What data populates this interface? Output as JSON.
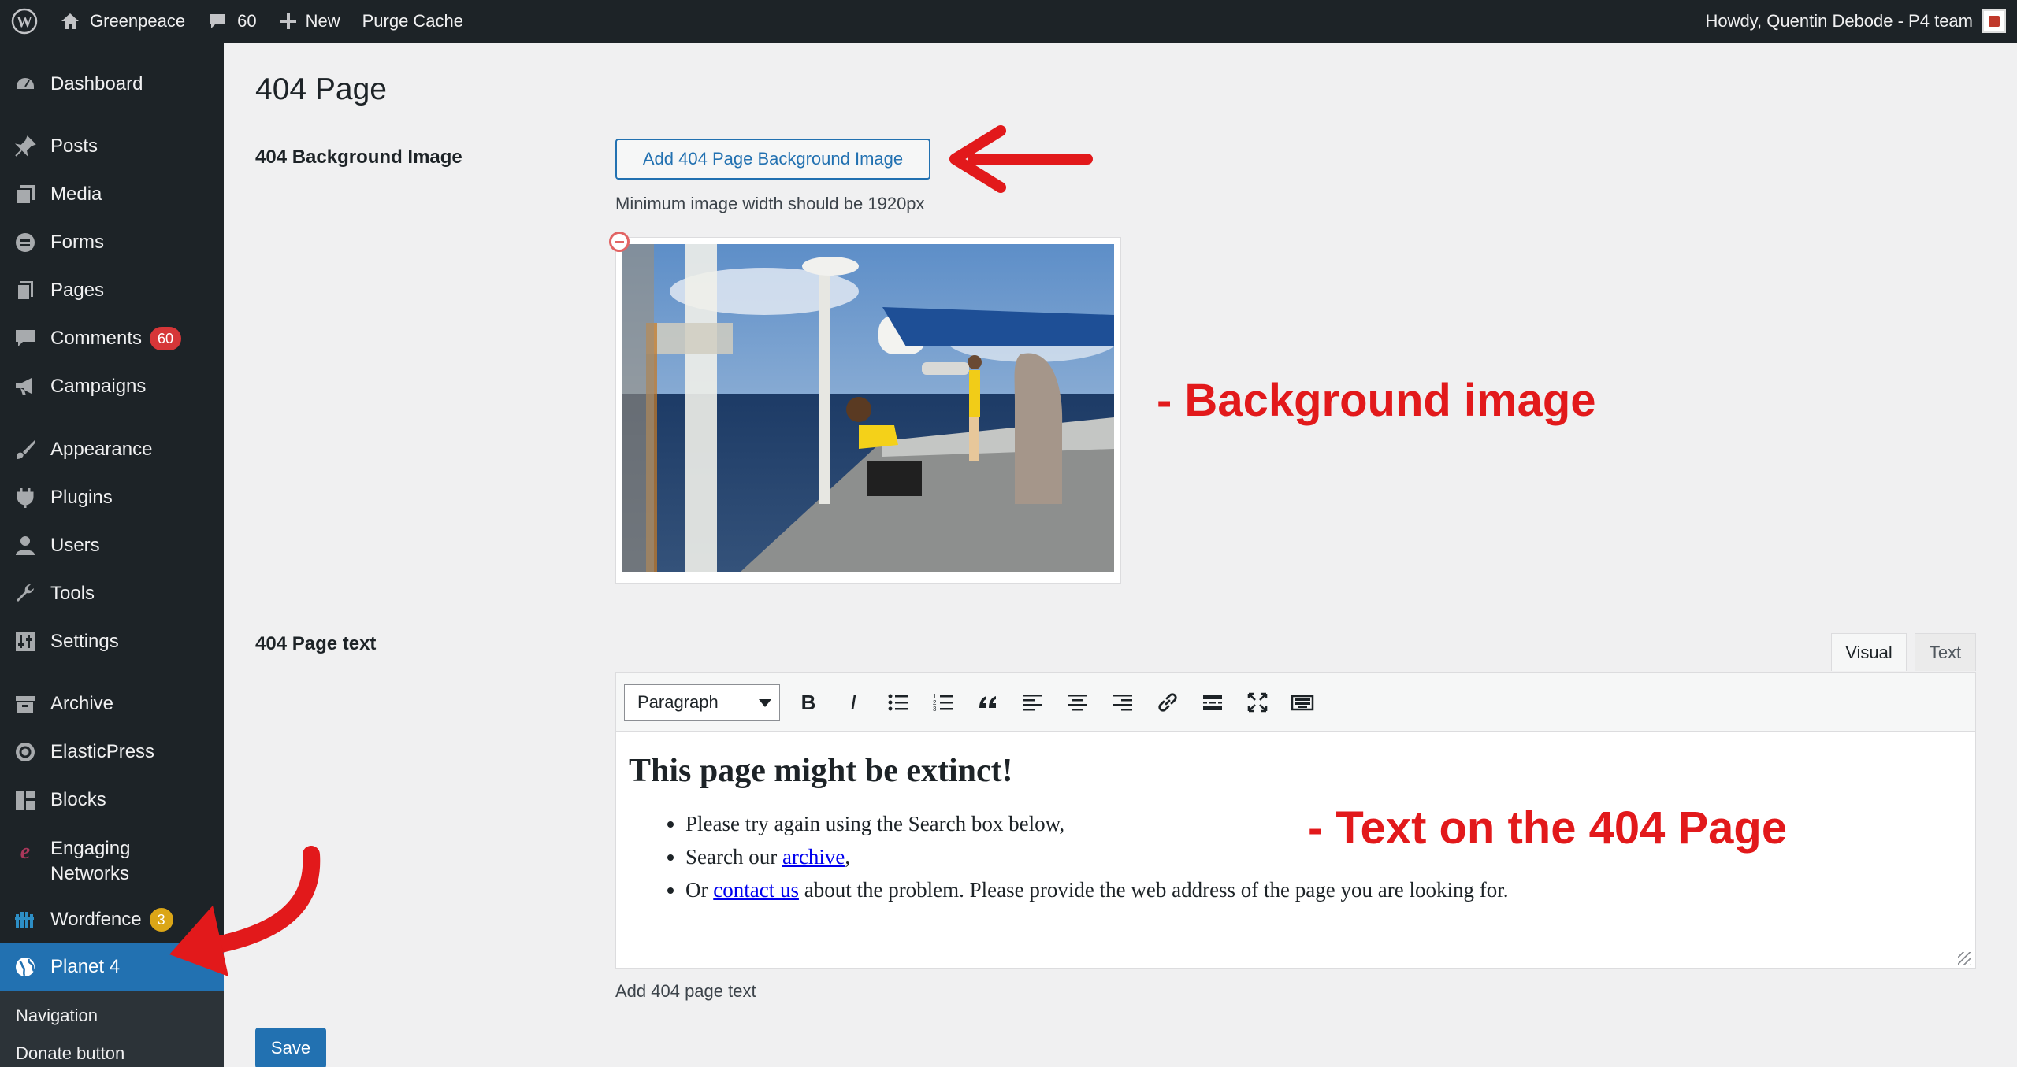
{
  "admin_bar": {
    "site_name": "Greenpeace",
    "comments_count": "60",
    "new_label": "New",
    "purge_cache_label": "Purge Cache",
    "greeting": "Howdy, Quentin Debode - P4 team"
  },
  "sidebar": {
    "items": [
      {
        "label": "Dashboard",
        "icon": "dashboard-icon"
      },
      {
        "label": "Posts",
        "icon": "pin-icon"
      },
      {
        "label": "Media",
        "icon": "media-icon"
      },
      {
        "label": "Forms",
        "icon": "forms-icon"
      },
      {
        "label": "Pages",
        "icon": "pages-icon"
      },
      {
        "label": "Comments",
        "icon": "comments-icon",
        "badge": "60"
      },
      {
        "label": "Campaigns",
        "icon": "megaphone-icon"
      },
      {
        "label": "Appearance",
        "icon": "brush-icon"
      },
      {
        "label": "Plugins",
        "icon": "plugin-icon"
      },
      {
        "label": "Users",
        "icon": "user-icon"
      },
      {
        "label": "Tools",
        "icon": "wrench-icon"
      },
      {
        "label": "Settings",
        "icon": "settings-icon"
      },
      {
        "label": "Archive",
        "icon": "archive-icon"
      },
      {
        "label": "ElasticPress",
        "icon": "elasticpress-icon"
      },
      {
        "label": "Blocks",
        "icon": "blocks-icon"
      },
      {
        "label": "Engaging Networks",
        "icon": "engaging-networks-icon"
      },
      {
        "label": "Wordfence",
        "icon": "wordfence-icon",
        "badge": "3"
      },
      {
        "label": "Planet 4",
        "icon": "globe-icon",
        "current": true
      }
    ],
    "submenu": [
      {
        "label": "Navigation"
      },
      {
        "label": "Donate button"
      }
    ]
  },
  "main": {
    "title": "404 Page",
    "bg_field_label": "404 Background Image",
    "add_bg_button": "Add 404 Page Background Image",
    "min_width_note": "Minimum image width should be 1920px",
    "text_field_label": "404 Page text",
    "editor": {
      "tab_visual": "Visual",
      "tab_text": "Text",
      "format_value": "Paragraph",
      "toolbar_buttons": [
        "bold-icon",
        "italic-icon",
        "bulleted-list-icon",
        "numbered-list-icon",
        "blockquote-icon",
        "align-left-icon",
        "align-center-icon",
        "align-right-icon",
        "link-icon",
        "read-more-icon",
        "fullscreen-icon",
        "keyboard-icon"
      ],
      "heading": "This page might be extinct!",
      "list": {
        "item1": "Please try again using the Search box below,",
        "item2_prefix": "Search our ",
        "item2_link": "archive",
        "item2_suffix": ",",
        "item3_prefix": "Or ",
        "item3_link": "contact us",
        "item3_suffix": " about the problem. Please provide the web address of the page you are looking for."
      }
    },
    "text_field_hint": "Add 404 page text",
    "save_button": "Save"
  },
  "annotations": {
    "background_image": "- Background image",
    "page_text": "- Text on the 404 Page",
    "color": "#e2191b"
  },
  "colors": {
    "admin_dark": "#1d2327",
    "accent_blue": "#2271b1",
    "badge_red": "#d63638",
    "badge_yellow": "#dba617"
  }
}
